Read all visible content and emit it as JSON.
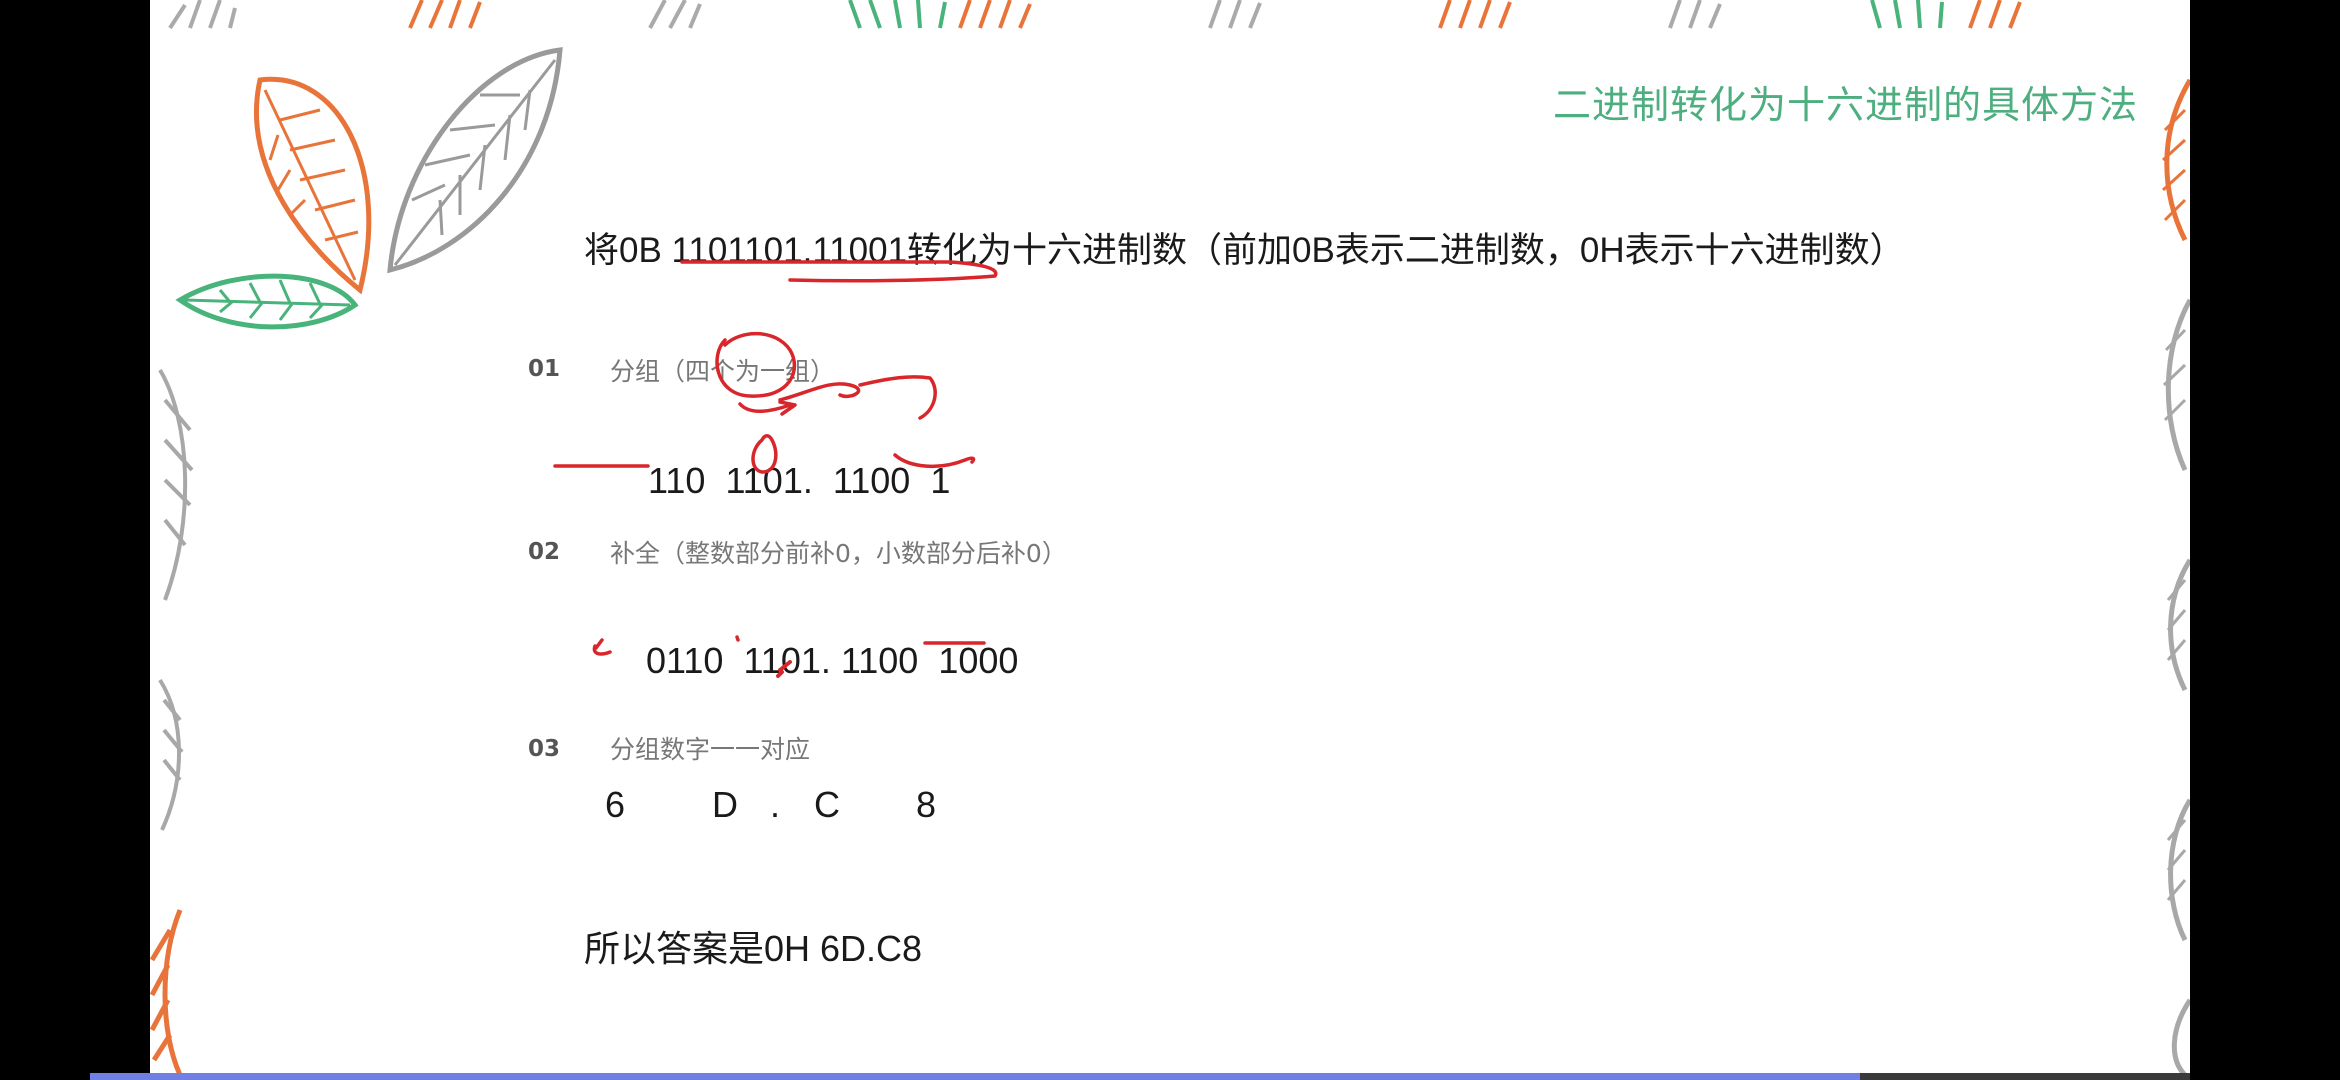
{
  "slide": {
    "title": "二进制转化为十六进制的具体方法",
    "question": "将0B 1101101.11001转化为十六进制数（前加0B表示二进制数，0H表示十六进制数）",
    "steps": [
      {
        "number": "01",
        "label": "分组（四个为一组）",
        "values": [
          "110",
          "1101",
          ".",
          "1100",
          "1"
        ]
      },
      {
        "number": "02",
        "label": "补全（整数部分前补0，小数部分后补0）",
        "values": [
          "0110",
          "1101",
          ".",
          "1100",
          "1000"
        ]
      },
      {
        "number": "03",
        "label": "分组数字一一对应",
        "values": [
          "6",
          "D",
          ".",
          "C",
          "8"
        ]
      }
    ],
    "answer": "所以答案是0H 6D.C8"
  },
  "colors": {
    "title": "#4dae7f",
    "ink": "#d8262a",
    "leaf_orange": "#e8743a",
    "leaf_green": "#48b37a",
    "leaf_gray": "#9a9a9a",
    "progress": "#6f7fe6"
  },
  "playback": {
    "progress": 0.843
  }
}
